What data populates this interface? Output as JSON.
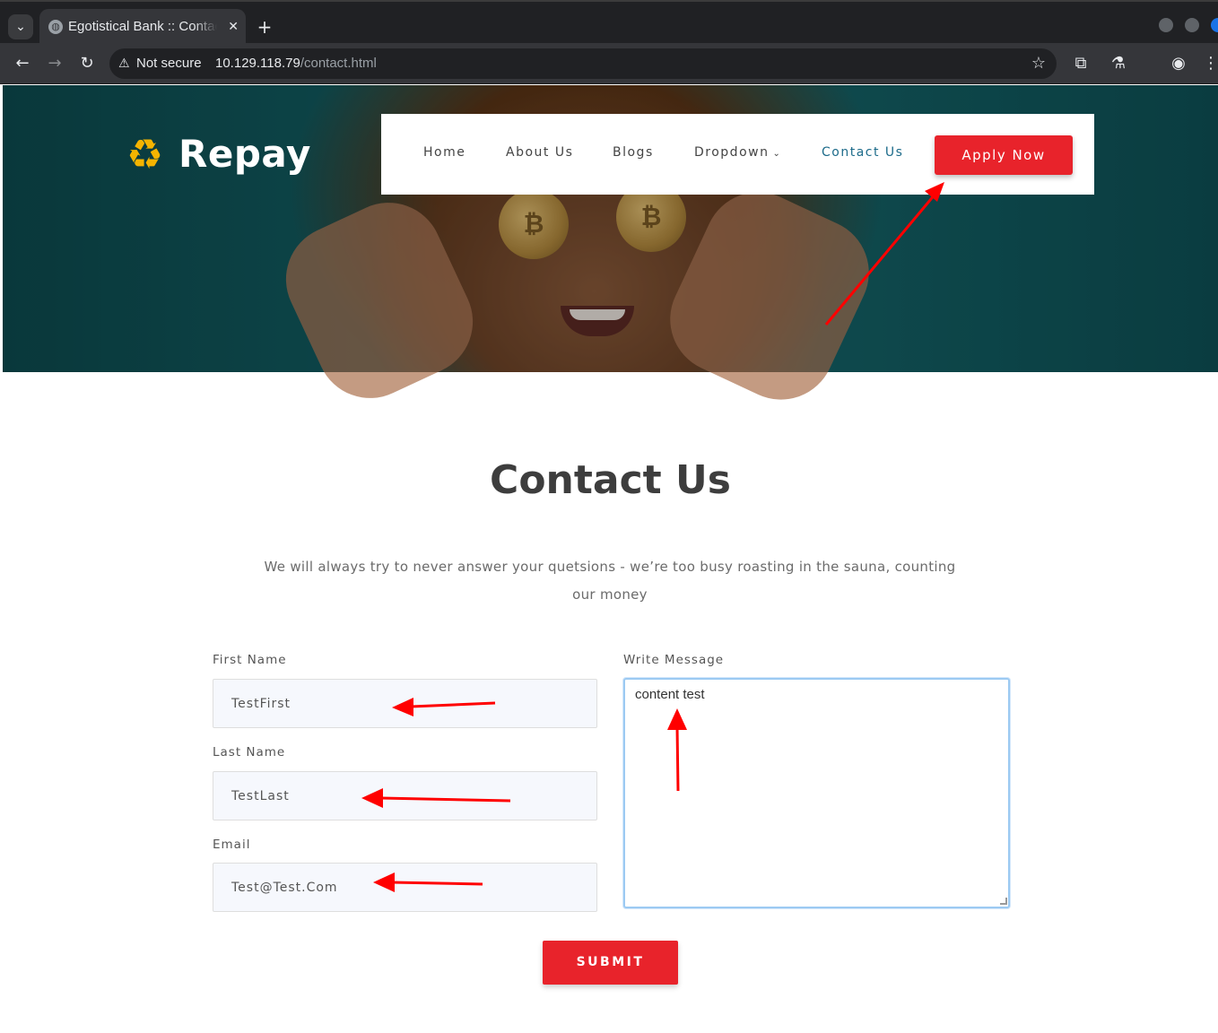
{
  "browser": {
    "tab_title": "Egotistical Bank :: Contact",
    "tab_list_icon": "chevron-down-icon",
    "security_label": "Not secure",
    "url_host": "10.129.118.79",
    "url_path": "/contact.html"
  },
  "site": {
    "logo_text": "Repay",
    "nav": {
      "home": "Home",
      "about": "About Us",
      "blogs": "Blogs",
      "dropdown": "Dropdown",
      "contact": "Contact Us",
      "apply": "Apply Now"
    },
    "accent_color": "#e8232b",
    "active_nav_color": "#1d6b8a"
  },
  "contact": {
    "title": "Contact Us",
    "description": "We will always try to never answer your quetsions - we’re too busy roasting in the sauna, counting our money",
    "first_name_label": "First Name",
    "first_name_value": "TestFirst",
    "last_name_label": "Last Name",
    "last_name_value": "TestLast",
    "email_label": "Email",
    "email_value": "Test@Test.Com",
    "message_label": "Write Message",
    "message_value": "content test",
    "submit_label": "SUBMIT"
  },
  "annotations": {
    "arrow_color": "#ff0000"
  }
}
